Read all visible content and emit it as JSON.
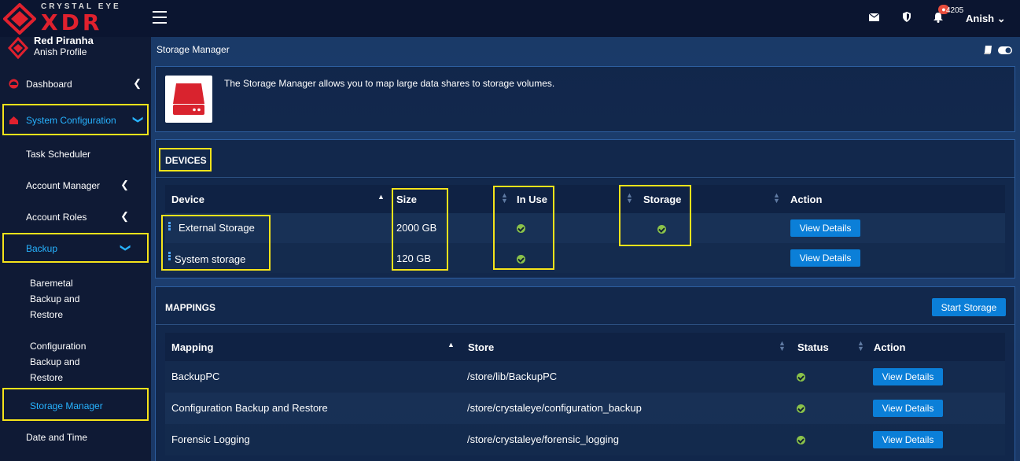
{
  "brand": {
    "tagline": "CRYSTAL EYE",
    "product": "XDR",
    "accent_color": "#e0212e"
  },
  "topbar": {
    "notification_count": "4205",
    "user_name": "Anish"
  },
  "profile": {
    "org": "Red Piranha",
    "name": "Anish Profile"
  },
  "sidebar": {
    "items": [
      {
        "label": "Dashboard",
        "icon": "dashboard-icon"
      },
      {
        "label": "System Configuration",
        "icon": "system-config-icon"
      },
      {
        "label": "Task Scheduler"
      },
      {
        "label": "Account Manager"
      },
      {
        "label": "Account Roles"
      },
      {
        "label": "Backup"
      },
      {
        "label_lines": [
          "Baremetal",
          "Backup and",
          "Restore"
        ]
      },
      {
        "label_lines": [
          "Configuration",
          "Backup and",
          "Restore"
        ]
      },
      {
        "label": "Storage Manager"
      },
      {
        "label": "Date and Time"
      }
    ]
  },
  "page": {
    "title": "Storage Manager",
    "info_text": "The Storage Manager allows you to map large data shares to storage volumes."
  },
  "devices": {
    "heading": "DEVICES",
    "columns": [
      "Device",
      "Size",
      "In Use",
      "Storage",
      "Action"
    ],
    "rows": [
      {
        "device": "External Storage",
        "size": "2000 GB",
        "in_use": true,
        "storage": true,
        "action": "View Details"
      },
      {
        "device": "System storage",
        "size": "120 GB",
        "in_use": true,
        "storage": false,
        "action": "View Details"
      }
    ]
  },
  "mappings": {
    "heading": "MAPPINGS",
    "start_button": "Start Storage",
    "columns": [
      "Mapping",
      "Store",
      "Status",
      "Action"
    ],
    "rows": [
      {
        "mapping": "BackupPC",
        "store": "/store/lib/BackupPC",
        "status": true,
        "action": "View Details"
      },
      {
        "mapping": "Configuration Backup and Restore",
        "store": "/store/crystaleye/configuration_backup",
        "status": true,
        "action": "View Details"
      },
      {
        "mapping": "Forensic Logging",
        "store": "/store/crystaleye/forensic_logging",
        "status": true,
        "action": "View Details"
      }
    ]
  }
}
